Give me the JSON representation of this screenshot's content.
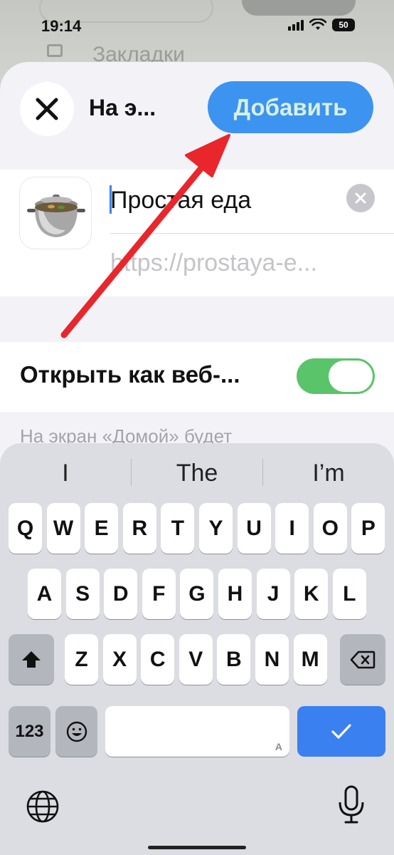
{
  "status_bar": {
    "time": "19:14",
    "battery": "50"
  },
  "background": {
    "behind_text": "Закладки"
  },
  "header": {
    "title": "На э...",
    "add_label": "Добавить"
  },
  "bookmark": {
    "name": "Простая еда",
    "url": "https://prostaya-e..."
  },
  "toggle": {
    "label": "Открыть как веб-...",
    "on": true
  },
  "footnote": "На экран «Домой» будет",
  "keyboard": {
    "suggestions": [
      "I",
      "The",
      "I’m"
    ],
    "row1": [
      "Q",
      "W",
      "E",
      "R",
      "T",
      "Y",
      "U",
      "I",
      "O",
      "P"
    ],
    "row2": [
      "A",
      "S",
      "D",
      "F",
      "G",
      "H",
      "J",
      "K",
      "L"
    ],
    "row3": [
      "Z",
      "X",
      "C",
      "V",
      "B",
      "N",
      "M"
    ],
    "numbers_label": "123",
    "space_hint": "A"
  },
  "colors": {
    "accent": "#3d93f0",
    "toggle_on": "#5ac46a",
    "arrow": "#e8262c"
  }
}
